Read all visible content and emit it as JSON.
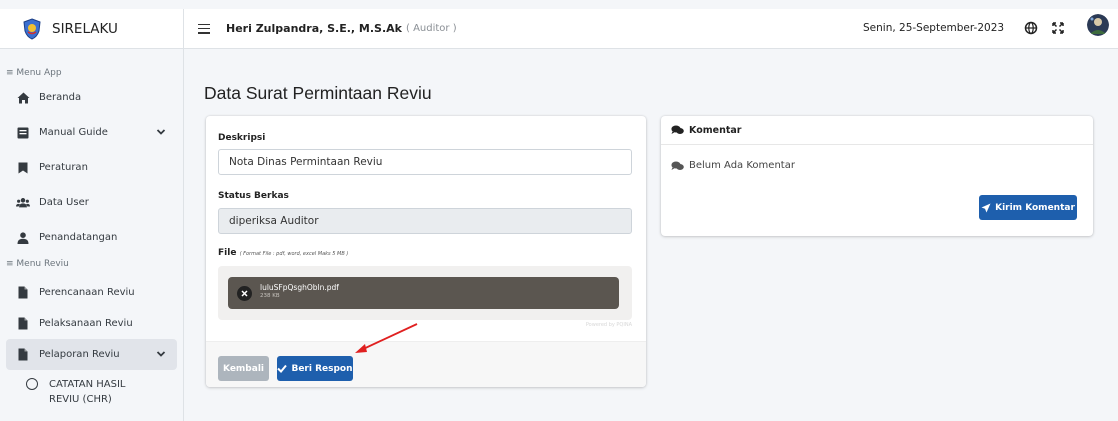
{
  "app": {
    "name": "SIRELAKU"
  },
  "topbar": {
    "user_name": "Heri Zulpandra, S.E., M.S.Ak",
    "user_role": "( Auditor )",
    "date": "Senin, 25-September-2023",
    "icons": [
      "menu-icon",
      "globe-icon",
      "fullscreen-icon",
      "avatar"
    ]
  },
  "sidebar": {
    "header_app": "≡ Menu App",
    "header_reviu": "≡ Menu Reviu",
    "items": [
      {
        "label": "Beranda",
        "icon": "home-icon"
      },
      {
        "label": "Manual Guide",
        "icon": "book-icon"
      },
      {
        "label": "Peraturan",
        "icon": "bookmark-icon"
      },
      {
        "label": "Data User",
        "icon": "users-icon"
      },
      {
        "label": "Penandatangan",
        "icon": "user-icon"
      },
      {
        "label": "Perencanaan Reviu",
        "icon": "file-icon"
      },
      {
        "label": "Pelaksanaan Reviu",
        "icon": "file-icon"
      },
      {
        "label": "Pelaporan Reviu",
        "icon": "file-icon"
      }
    ],
    "sub_item": "CATATAN HASIL REVIU (CHR)"
  },
  "page": {
    "title": "Data Surat Permintaan Reviu"
  },
  "form": {
    "description_label": "Deskripsi",
    "description_value": "Nota Dinas Permintaan Reviu",
    "status_label": "Status Berkas",
    "status_value": "diperiksa Auditor",
    "file_label": "File",
    "file_hint": "( Format File : pdf, word, excel Maks 5 MB )",
    "file_name": "luluSFpQsghObln.pdf",
    "file_size": "238 KB",
    "powered_by": "Powered by PQINA",
    "back_button": "Kembali",
    "respond_button": "Beri Respon"
  },
  "comments": {
    "header": "Komentar",
    "empty_text": "Belum Ada Komentar",
    "send_button": "Kirim Komentar"
  },
  "colors": {
    "primary": "#1e5fad",
    "secondary": "#adb5bd",
    "annotation_arrow": "#e02020",
    "file_item_bg": "#5b5650"
  }
}
